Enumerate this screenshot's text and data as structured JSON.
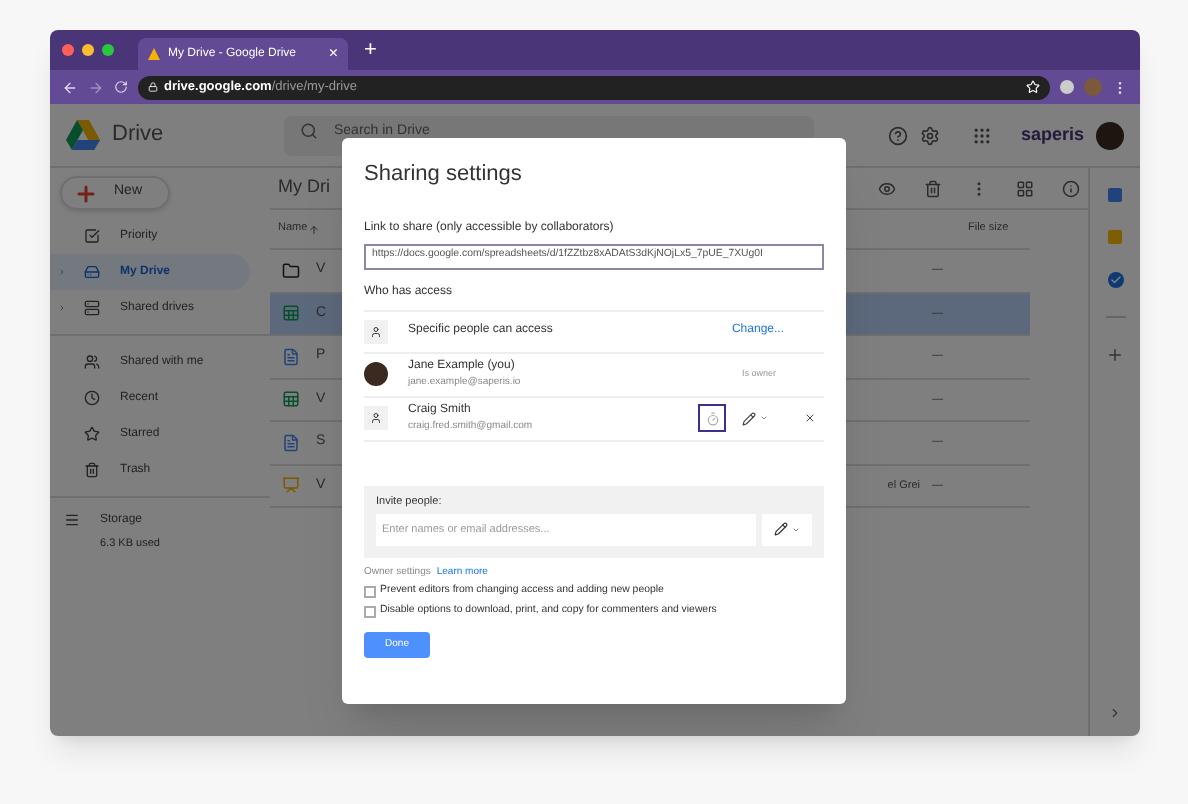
{
  "browser": {
    "tab": {
      "title": "My Drive - Google Drive",
      "close": "×"
    },
    "new_tab": "+",
    "url": {
      "domain": "drive.google.com",
      "path": "/drive/my-drive"
    }
  },
  "drive": {
    "app_name": "Drive",
    "search": {
      "placeholder": "Search in Drive"
    },
    "brand": "saperis",
    "new_button": "New",
    "sidebar": {
      "items": [
        {
          "label": "Priority",
          "selected": false,
          "expandable": false
        },
        {
          "label": "My Drive",
          "selected": true,
          "expandable": true
        },
        {
          "label": "Shared drives",
          "selected": false,
          "expandable": true
        },
        {
          "label": "Shared with me",
          "selected": false,
          "expandable": false
        },
        {
          "label": "Recent",
          "selected": false,
          "expandable": false
        },
        {
          "label": "Starred",
          "selected": false,
          "expandable": false
        },
        {
          "label": "Trash",
          "selected": false,
          "expandable": false
        }
      ],
      "storage": {
        "label": "Storage",
        "usage": "6.3 KB used"
      }
    },
    "title": "My Dri",
    "columns": {
      "name": "Name",
      "size": "File size"
    },
    "rows": [
      {
        "kind": "folder",
        "name": "V",
        "size": "—",
        "selected": false
      },
      {
        "kind": "sheet",
        "name": "C",
        "size": "—",
        "selected": true
      },
      {
        "kind": "doc",
        "name": "P",
        "size": "—",
        "selected": false
      },
      {
        "kind": "sheet",
        "name": "V",
        "size": "—",
        "selected": false
      },
      {
        "kind": "doc",
        "name": "S",
        "size": "—",
        "selected": false
      },
      {
        "kind": "slides",
        "name": "V",
        "owner": "el Grei",
        "size": "—",
        "selected": false
      }
    ]
  },
  "dialog": {
    "title": "Sharing settings",
    "link_label": "Link to share (only accessible by collaborators)",
    "link_value": "https://docs.google.com/spreadsheets/d/1fZZtbz8xADAtS3dKjNOjLx5_7pUE_7XUg0I",
    "access_heading": "Who has access",
    "access": {
      "label": "Specific people can access",
      "action": "Change..."
    },
    "people": [
      {
        "kind": "owner",
        "name": "Jane Example (you)",
        "email": "jane.example@saperis.io",
        "role": "Is owner"
      },
      {
        "kind": "editor",
        "name": "Craig Smith",
        "email": "craig.fred.smith@gmail.com",
        "expiry_highlighted": true
      }
    ],
    "invite": {
      "label": "Invite people:",
      "placeholder": "Enter names or email addresses..."
    },
    "owner_settings": {
      "label": "Owner settings",
      "link": "Learn more"
    },
    "options": [
      {
        "label": "Prevent editors from changing access and adding new people",
        "checked": false
      },
      {
        "label": "Disable options to download, print, and copy for commenters and viewers",
        "checked": false
      }
    ],
    "done": "Done"
  }
}
